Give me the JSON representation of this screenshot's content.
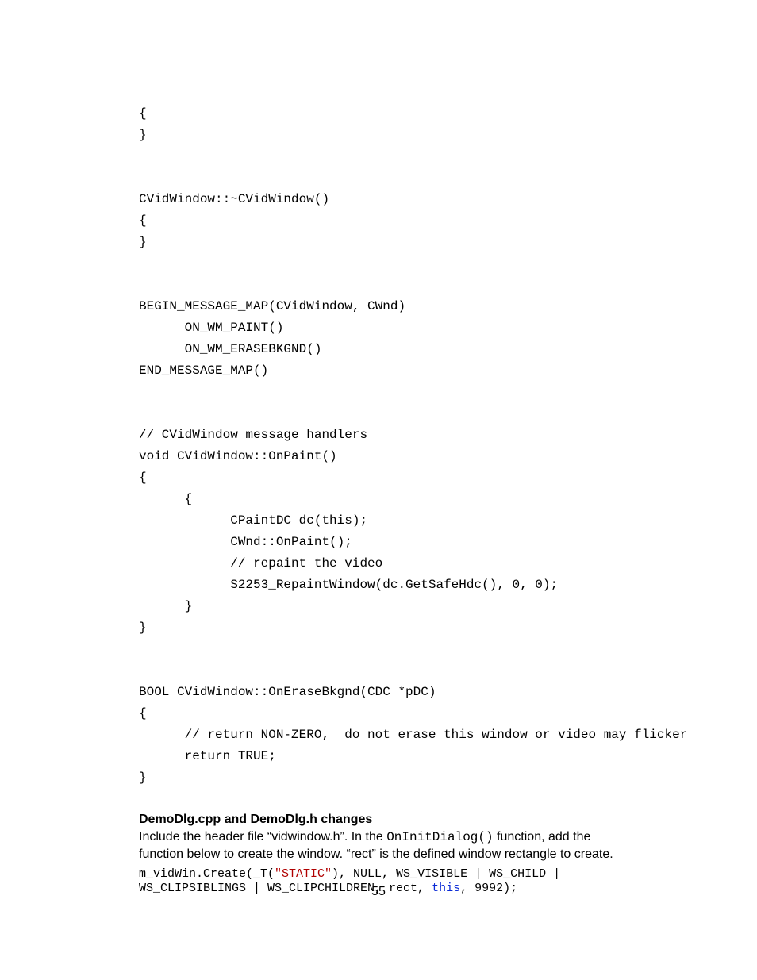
{
  "code_block": "{\n}\n\n\nCVidWindow::~CVidWindow()\n{\n}\n\n\nBEGIN_MESSAGE_MAP(CVidWindow, CWnd)\n      ON_WM_PAINT()\n      ON_WM_ERASEBKGND()\nEND_MESSAGE_MAP()\n\n\n// CVidWindow message handlers\nvoid CVidWindow::OnPaint()\n{\n      {\n            CPaintDC dc(this);\n            CWnd::OnPaint();\n            // repaint the video\n            S2253_RepaintWindow(dc.GetSafeHdc(), 0, 0);\n      }\n}\n\n\nBOOL CVidWindow::OnEraseBkgnd(CDC *pDC)\n{\n      // return NON-ZERO,  do not erase this window or video may flicker\n      return TRUE;\n}",
  "section_heading": "DemoDlg.cpp and DemoDlg.h changes",
  "prose": {
    "pre1": "Include the header file “vidwindow.h”.  In the ",
    "init_fn": "OnInitDialog()",
    "post1": " function, add the function below to create the window.  “rect” is the defined window rectangle to create."
  },
  "snippet": {
    "p1": "m_vidWin.Create(_T(",
    "str": "\"STATIC\"",
    "p2": "), NULL, WS_VISIBLE | WS_CHILD | WS_CLIPSIBLINGS | WS_CLIPCHILDREN, rect, ",
    "kw": "this",
    "p3": ", 9992);"
  },
  "page_number": "55"
}
